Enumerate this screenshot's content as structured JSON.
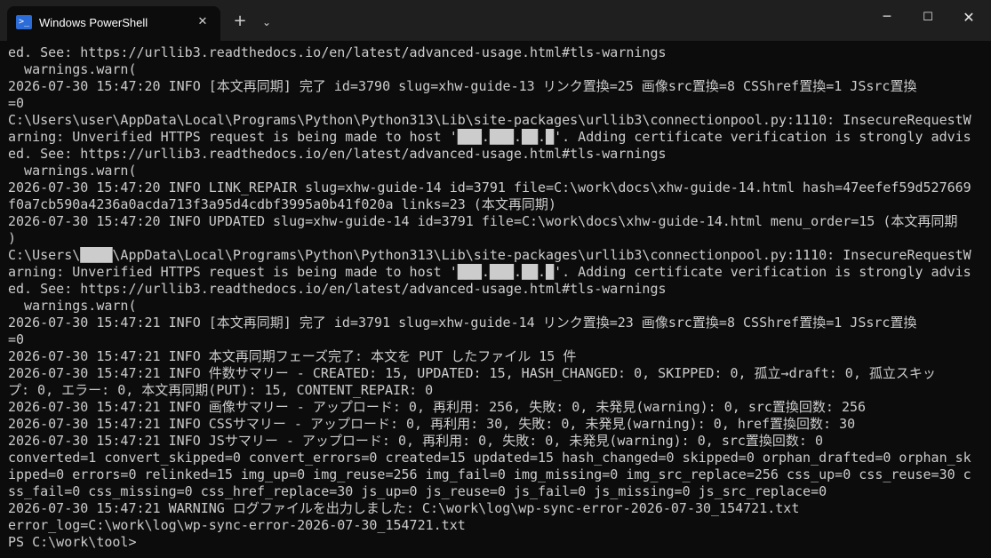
{
  "window": {
    "tab_title": "Windows PowerShell",
    "tab_icon": "powershell-icon",
    "new_tab_glyph": "+",
    "dropdown_glyph": "⌄",
    "tab_close_glyph": "✕",
    "minimize_glyph": "─",
    "maximize_glyph": "☐",
    "close_glyph": "✕"
  },
  "terminal": {
    "lines": [
      "ed. See: https://urllib3.readthedocs.io/en/latest/advanced-usage.html#tls-warnings",
      "  warnings.warn(",
      "2026-07-30 15:47:20 INFO [本文再同期] 完了 id=3790 slug=xhw-guide-13 リンク置換=25 画像src置換=8 CSShref置換=1 JSsrc置換",
      "=0",
      "C:\\Users\\user\\AppData\\Local\\Programs\\Python\\Python313\\Lib\\site-packages\\urllib3\\connectionpool.py:1110: InsecureRequestW",
      "arning: Unverified HTTPS request is being made to host '███.███.██.█'. Adding certificate verification is strongly advis",
      "ed. See: https://urllib3.readthedocs.io/en/latest/advanced-usage.html#tls-warnings",
      "  warnings.warn(",
      "2026-07-30 15:47:20 INFO LINK_REPAIR slug=xhw-guide-14 id=3791 file=C:\\work\\docs\\xhw-guide-14.html hash=47eefef59d527669",
      "f0a7cb590a4236a0acda713f3a95d4cdbf3995a0b41f020a links=23 (本文再同期)",
      "2026-07-30 15:47:20 INFO UPDATED slug=xhw-guide-14 id=3791 file=C:\\work\\docs\\xhw-guide-14.html menu_order=15 (本文再同期",
      ")",
      "C:\\Users\\████\\AppData\\Local\\Programs\\Python\\Python313\\Lib\\site-packages\\urllib3\\connectionpool.py:1110: InsecureRequestW",
      "arning: Unverified HTTPS request is being made to host '███.███.██.█'. Adding certificate verification is strongly advis",
      "ed. See: https://urllib3.readthedocs.io/en/latest/advanced-usage.html#tls-warnings",
      "  warnings.warn(",
      "2026-07-30 15:47:21 INFO [本文再同期] 完了 id=3791 slug=xhw-guide-14 リンク置換=23 画像src置換=8 CSShref置換=1 JSsrc置換",
      "=0",
      "2026-07-30 15:47:21 INFO 本文再同期フェーズ完了: 本文を PUT したファイル 15 件",
      "2026-07-30 15:47:21 INFO 件数サマリー - CREATED: 15, UPDATED: 15, HASH_CHANGED: 0, SKIPPED: 0, 孤立→draft: 0, 孤立スキッ",
      "プ: 0, エラー: 0, 本文再同期(PUT): 15, CONTENT_REPAIR: 0",
      "2026-07-30 15:47:21 INFO 画像サマリー - アップロード: 0, 再利用: 256, 失敗: 0, 未発見(warning): 0, src置換回数: 256",
      "2026-07-30 15:47:21 INFO CSSサマリー - アップロード: 0, 再利用: 30, 失敗: 0, 未発見(warning): 0, href置換回数: 30",
      "2026-07-30 15:47:21 INFO JSサマリー - アップロード: 0, 再利用: 0, 失敗: 0, 未発見(warning): 0, src置換回数: 0",
      "converted=1 convert_skipped=0 convert_errors=0 created=15 updated=15 hash_changed=0 skipped=0 orphan_drafted=0 orphan_sk",
      "ipped=0 errors=0 relinked=15 img_up=0 img_reuse=256 img_fail=0 img_missing=0 img_src_replace=256 css_up=0 css_reuse=30 c",
      "ss_fail=0 css_missing=0 css_href_replace=30 js_up=0 js_reuse=0 js_fail=0 js_missing=0 js_src_replace=0",
      "2026-07-30 15:47:21 WARNING ログファイルを出力しました: C:\\work\\log\\wp-sync-error-2026-07-30_154721.txt",
      "error_log=C:\\work\\log\\wp-sync-error-2026-07-30_154721.txt",
      "PS C:\\work\\tool> "
    ]
  }
}
